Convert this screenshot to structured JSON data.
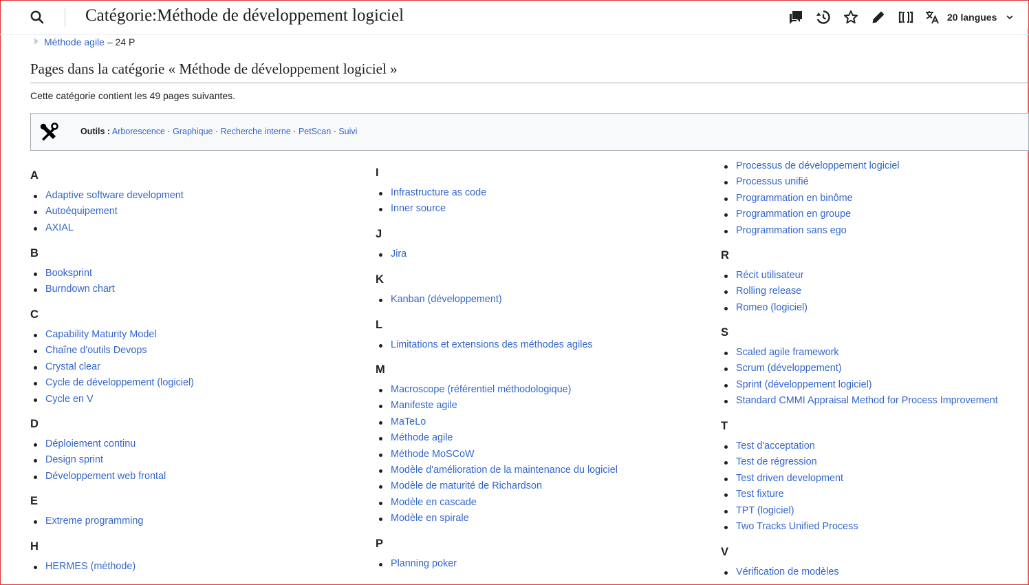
{
  "header": {
    "title": "Catégorie:Méthode de développement logiciel",
    "languages_label": "20 langues",
    "icons": [
      "search-icon",
      "talk-icon",
      "history-icon",
      "watch-star-icon",
      "edit-pencil-icon",
      "wikidata-brackets-icon",
      "language-icon",
      "chevron-down-icon"
    ]
  },
  "subcategory": {
    "link": "Méthode agile",
    "suffix": "– 24 P"
  },
  "section_heading": "Pages dans la catégorie « Méthode de développement logiciel »",
  "intro": "Cette catégorie contient les 49 pages suivantes.",
  "toolbox": {
    "label": "Outils :",
    "links": [
      "Arborescence",
      "Graphique",
      "Recherche interne",
      "PetScan",
      "Suivi"
    ],
    "separator": "·"
  },
  "columns": [
    {
      "groups": [
        {
          "letter": "A",
          "items": [
            "Adaptive software development",
            "Autoéquipement",
            "AXIAL"
          ]
        },
        {
          "letter": "B",
          "items": [
            "Booksprint",
            "Burndown chart"
          ]
        },
        {
          "letter": "C",
          "items": [
            "Capability Maturity Model",
            "Chaîne d'outils Devops",
            "Crystal clear",
            "Cycle de développement (logiciel)",
            "Cycle en V"
          ]
        },
        {
          "letter": "D",
          "items": [
            "Déploiement continu",
            "Design sprint",
            "Développement web frontal"
          ]
        },
        {
          "letter": "E",
          "items": [
            "Extreme programming"
          ]
        },
        {
          "letter": "H",
          "items": [
            "HERMES (méthode)"
          ]
        }
      ]
    },
    {
      "groups": [
        {
          "letter": "I",
          "items": [
            "Infrastructure as code",
            "Inner source"
          ]
        },
        {
          "letter": "J",
          "items": [
            "Jira"
          ]
        },
        {
          "letter": "K",
          "items": [
            "Kanban (développement)"
          ]
        },
        {
          "letter": "L",
          "items": [
            "Limitations et extensions des méthodes agiles"
          ]
        },
        {
          "letter": "M",
          "items": [
            "Macroscope (référentiel méthodologique)",
            "Manifeste agile",
            "MaTeLo",
            "Méthode agile",
            "Méthode MoSCoW",
            "Modèle d'amélioration de la maintenance du logiciel",
            "Modèle de maturité de Richardson",
            "Modèle en cascade",
            "Modèle en spirale"
          ]
        },
        {
          "letter": "P",
          "items": [
            "Planning poker"
          ]
        }
      ]
    },
    {
      "groups": [
        {
          "letter": "",
          "items": [
            "Processus de développement logiciel",
            "Processus unifié",
            "Programmation en binôme",
            "Programmation en groupe",
            "Programmation sans ego"
          ]
        },
        {
          "letter": "R",
          "items": [
            "Récit utilisateur",
            "Rolling release",
            "Romeo (logiciel)"
          ]
        },
        {
          "letter": "S",
          "items": [
            "Scaled agile framework",
            "Scrum (développement)",
            "Sprint (développement logiciel)",
            "Standard CMMI Appraisal Method for Process Improvement"
          ]
        },
        {
          "letter": "T",
          "items": [
            "Test d'acceptation",
            "Test de régression",
            "Test driven development",
            "Test fixture",
            "TPT (logiciel)",
            "Two Tracks Unified Process"
          ]
        },
        {
          "letter": "V",
          "items": [
            "Vérification de modèles"
          ]
        }
      ]
    }
  ]
}
